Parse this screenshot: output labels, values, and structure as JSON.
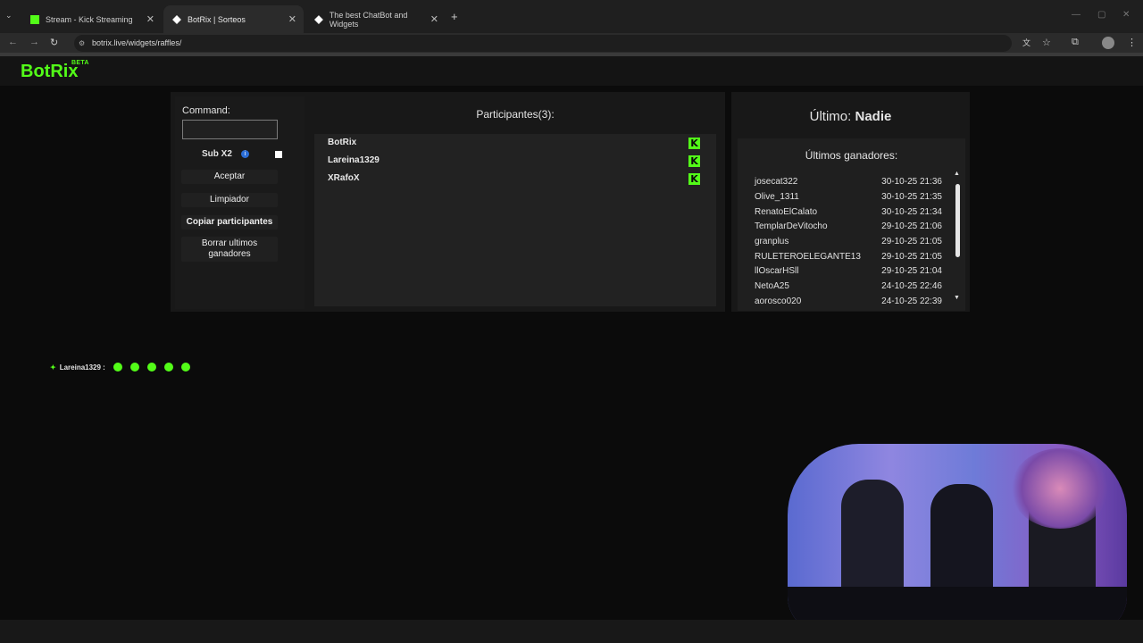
{
  "browser": {
    "tabs": [
      {
        "title": "Stream - Kick Streaming",
        "active": false
      },
      {
        "title": "BotRix | Sorteos",
        "active": true
      },
      {
        "title": "The best ChatBot and Widgets",
        "active": false
      }
    ],
    "url": "botrix.live/widgets/raffles/"
  },
  "site": {
    "logo": "BotRix",
    "badge": "BETA"
  },
  "controls": {
    "command_label": "Command:",
    "command_value": "",
    "sub_label": "Sub X2",
    "buttons": {
      "accept": "Aceptar",
      "clear": "Limpiador",
      "copy": "Copiar participantes",
      "delete_line1": "Borrar ultimos",
      "delete_line2": "ganadores"
    }
  },
  "participants": {
    "title": "Participantes(3):",
    "list": [
      "BotRix",
      "Lareina1329",
      "XRafoX"
    ]
  },
  "winners": {
    "last_prefix": "Último:",
    "last_name": "Nadie",
    "title": "Últimos ganadores:",
    "list": [
      {
        "name": "josecat322",
        "time": "30-10-25 21:36"
      },
      {
        "name": "Olive_1311",
        "time": "30-10-25 21:35"
      },
      {
        "name": "RenatoElCalato",
        "time": "30-10-25 21:34"
      },
      {
        "name": "TemplarDeVitocho",
        "time": "29-10-25 21:06"
      },
      {
        "name": "granplus",
        "time": "29-10-25 21:05"
      },
      {
        "name": "RULETEROELEGANTE13",
        "time": "29-10-25 21:05"
      },
      {
        "name": "llOscarHSll",
        "time": "29-10-25 21:04"
      },
      {
        "name": "NetoA25",
        "time": "24-10-25 22:46"
      },
      {
        "name": "aorosco020",
        "time": "24-10-25 22:39"
      }
    ]
  },
  "chat": {
    "user": "Lareina1329 :"
  },
  "colors": {
    "accent": "#53fc18",
    "background": "#0b0b0b"
  }
}
